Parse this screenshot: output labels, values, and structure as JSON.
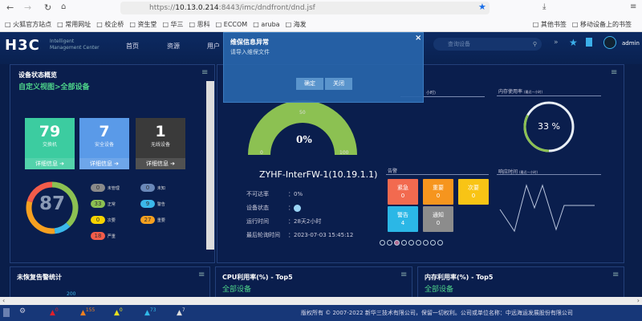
{
  "browser": {
    "url_prefix": "https://",
    "url_host": "10.13.0.214",
    "url_path": ":8443/imc/dndfront/dnd.jsf"
  },
  "bookmarks": [
    "火狐官方站点",
    "常用网址",
    "校企桥",
    "资生堂",
    "华三",
    "思科",
    "ECCOM",
    "aruba",
    "海发"
  ],
  "bookmarks_right": [
    "其他书签",
    "移动设备上的书签"
  ],
  "header": {
    "logo": "H3C",
    "logo_sub1": "Intelligent",
    "logo_sub2": "Management Center",
    "nav": [
      "首页",
      "资源",
      "用户"
    ],
    "search_placeholder": "查询设备",
    "user": "admin"
  },
  "modal": {
    "title": "维保信息异常",
    "message": "请导入维保文件",
    "ok": "确定",
    "close": "关闭"
  },
  "device_overview": {
    "title": "设备状态概览",
    "view": "自定义视图>全部设备",
    "tiles": [
      {
        "count": "79",
        "label": "交换机",
        "detail": "详细信息",
        "color": "#3ccca0"
      },
      {
        "count": "7",
        "label": "安全设备",
        "detail": "详细信息",
        "color": "#5a9ae8"
      },
      {
        "count": "1",
        "label": "无线设备",
        "detail": "详细信息",
        "color": "#3a3a3a"
      }
    ],
    "total": "87",
    "legend": [
      {
        "value": "0",
        "label": "未管理",
        "color": "#8a8a8a"
      },
      {
        "value": "0",
        "label": "未知",
        "color": "#6a88b8"
      },
      {
        "value": "33",
        "label": "正常",
        "color": "#8cc152"
      },
      {
        "value": "9",
        "label": "警告",
        "color": "#3bb8ea"
      },
      {
        "value": "0",
        "label": "次要",
        "color": "#f6d200"
      },
      {
        "value": "27",
        "label": "重要",
        "color": "#f6a020"
      },
      {
        "value": "18",
        "label": "严重",
        "color": "#f25c4a"
      }
    ]
  },
  "device_detail": {
    "gauge_value": 0,
    "gauge_label": "0%",
    "gauge_min": "0",
    "gauge_mid": "50",
    "gauge_max": "100",
    "cpu_title_suffix": "小时)",
    "name": "ZYHF-InterFW-1(10.19.1.1)",
    "rows": [
      {
        "k": "不可达率",
        "v": "：0%"
      },
      {
        "k": "设备状态",
        "v": "："
      },
      {
        "k": "运行时间",
        "v": "：28天2小时"
      },
      {
        "k": "最后轮询时间",
        "v": "：2023-07-03 15:45:12"
      }
    ],
    "memory_title": "内存使用率",
    "memory_sub": "(最近一小时)",
    "memory_value": 33,
    "memory_label": "33 %",
    "alarm_title": "告警",
    "alarms": [
      {
        "label": "紧急",
        "value": "0",
        "color": "#f26a4f"
      },
      {
        "label": "重要",
        "value": "0",
        "color": "#f6951e"
      },
      {
        "label": "次要",
        "value": "0",
        "color": "#f8c415"
      },
      {
        "label": "警告",
        "value": "4",
        "color": "#2bb7e6"
      },
      {
        "label": "通知",
        "value": "0",
        "color": "#8c8c8c"
      }
    ],
    "response_title": "响应时间",
    "response_sub": "(最近一小时)",
    "pager_active": 3,
    "pager_count": 9
  },
  "bottom": [
    {
      "title": "未恢复告警统计",
      "sub": "",
      "axis": "200"
    },
    {
      "title": "CPU利用率(%) - Top5",
      "sub": "全部设备"
    },
    {
      "title": "内存利用率(%) - Top5",
      "sub": "全部设备"
    }
  ],
  "status": {
    "counts": [
      {
        "value": "0",
        "color": "#e0202a"
      },
      {
        "value": "155",
        "color": "#f08020"
      },
      {
        "value": "0",
        "color": "#e8e020"
      },
      {
        "value": "73",
        "color": "#30b8e8"
      },
      {
        "value": "7",
        "color": "#dddddd"
      }
    ],
    "copyright": "版权所有 © 2007-2022 新华三技术有限公司，保留一切权利。公司或单位名称：中远海运发展股份有限公司"
  }
}
